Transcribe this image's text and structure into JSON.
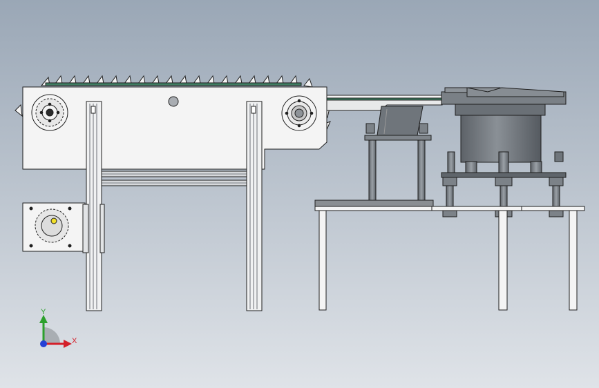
{
  "viewport": {
    "background_top": "#9aa7b6",
    "background_bottom": "#dfe3e8"
  },
  "colors": {
    "part_white": "#f4f4f4",
    "outline": "#1e1e1e",
    "frame_grey": "#c9ccd0",
    "bowl_grey": "#6d7278",
    "bowl_dark": "#4d5257",
    "plate_grey": "#8a8e92",
    "belt_green": "#3f7d62",
    "axis_x": "#d4202a",
    "axis_y": "#2ca02c",
    "axis_z": "#2540d6"
  },
  "triad": {
    "x_label": "X",
    "y_label": "Y"
  }
}
